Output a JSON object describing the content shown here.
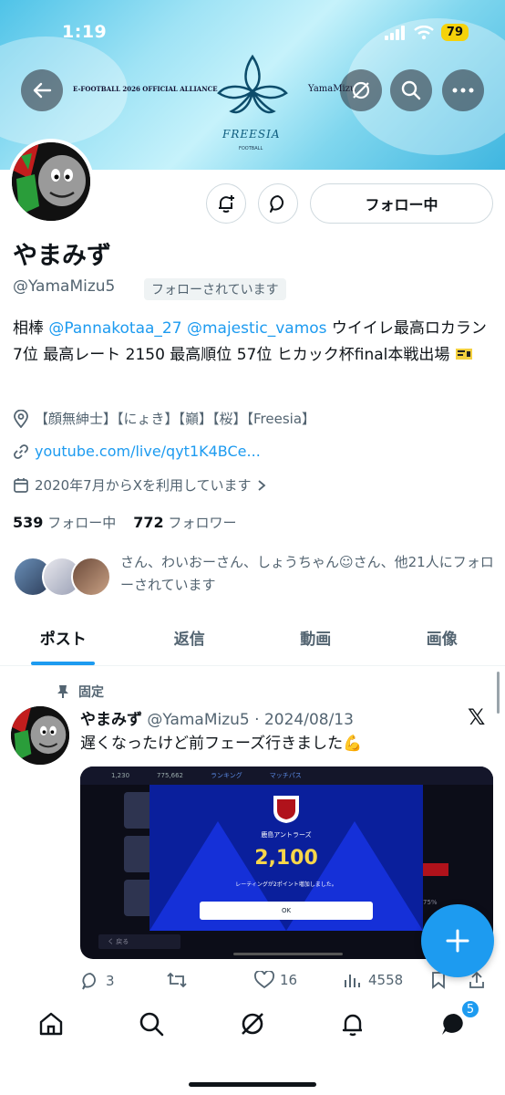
{
  "status_bar": {
    "time": "1:19",
    "battery": "79"
  },
  "banner": {
    "left_text": "E-FOOTBALL 2026 OFFICIAL ALLIANCE",
    "right_text": "YamaMizu",
    "brand": "FREESIA",
    "sub": "FOOTBALL"
  },
  "profile": {
    "name": "やまみず",
    "handle": "@YamaMizu5",
    "follows_you": "フォローされています",
    "follow_button": "フォロー中",
    "bio_prefix": "相棒 ",
    "bio_mention_1": "@Pannakotaa_27",
    "bio_mention_2": "@majestic_vamos",
    "bio_rest": " ウイイレ最高ロカラン7位 最高レート 2150 最高順位 57位 ヒカック杯final本戦出場",
    "location": "【顔無紳士】【にょき】【巓】【桜】【Freesia】",
    "link": "youtube.com/live/qyt1K4BCe...",
    "joined": "2020年7月からXを利用しています",
    "following_count": "539",
    "following_label": "フォロー中",
    "followers_count": "772",
    "followers_label": "フォロワー",
    "followed_by": "さん、わいおーさん、しょうちゃん☺さん、他21人にフォローされています"
  },
  "tabs": [
    {
      "label": "ポスト",
      "active": true
    },
    {
      "label": "返信",
      "active": false
    },
    {
      "label": "動画",
      "active": false
    },
    {
      "label": "画像",
      "active": false
    }
  ],
  "post": {
    "pinned_label": "固定",
    "name": "やまみず",
    "handle_date": "@YamaMizu5 · 2024/08/13",
    "text": "遅くなったけど前フェーズ行きました💪",
    "media": {
      "coins": "1,230",
      "points": "775,662",
      "ranking": "ランキング",
      "match_pass": "マッチパス",
      "team": "鹿島アントラーズ",
      "rating": "2,100",
      "message": "レーティングが2ポイント増加しました。",
      "ok": "OK",
      "back": "く 戻る",
      "percent": "75%"
    },
    "replies": "3",
    "likes": "16",
    "views": "4558"
  },
  "nav": {
    "messages_badge": "5"
  },
  "colors": {
    "accent": "#1d9bf0",
    "text": "#0f1419",
    "muted": "#536471"
  }
}
